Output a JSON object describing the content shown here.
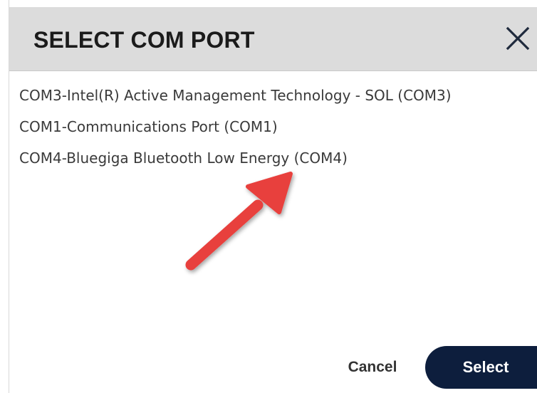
{
  "dialog": {
    "title": "SELECT COM PORT",
    "close_icon": "close-icon"
  },
  "ports": [
    {
      "label": "COM3-Intel(R) Active Management Technology - SOL (COM3)"
    },
    {
      "label": "COM1-Communications Port (COM1)"
    },
    {
      "label": "COM4-Bluegiga Bluetooth Low Energy (COM4)"
    }
  ],
  "annotation": {
    "icon": "red-arrow-icon",
    "color": "#e8413e",
    "points_to": "COM4-Bluegiga Bluetooth Low Energy (COM4)"
  },
  "footer": {
    "cancel_label": "Cancel",
    "select_label": "Select"
  },
  "colors": {
    "titlebar_bg": "#dcdcdc",
    "primary_button_bg": "#0d1e3d",
    "primary_button_text": "#ffffff",
    "text": "#3a3a3a"
  }
}
